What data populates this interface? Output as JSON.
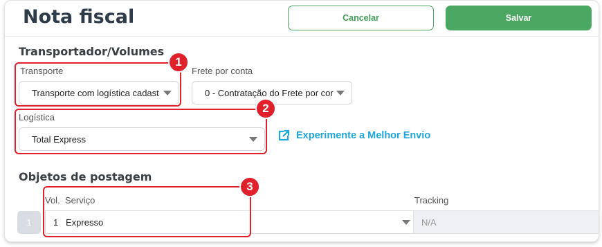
{
  "header": {
    "title": "Nota fiscal",
    "cancel_label": "Cancelar",
    "save_label": "Salvar"
  },
  "transport_section": {
    "title": "Transportador/Volumes",
    "transporte_label": "Transporte",
    "transporte_value": "Transporte com logística cadast",
    "frete_label": "Frete por conta",
    "frete_value": "0 - Contratação do Frete por cor",
    "logistica_label": "Logística",
    "logistica_value": "Total Express",
    "link_label": "Experimente a Melhor Envio"
  },
  "objects_section": {
    "title": "Objetos de postagem",
    "col_vol": "Vol.",
    "col_servico": "Serviço",
    "col_tracking": "Tracking",
    "rows": [
      {
        "num": "1",
        "vol": "1",
        "servico": "Expresso",
        "tracking": "N/A"
      }
    ]
  },
  "annotations": [
    "1",
    "2",
    "3"
  ],
  "colors": {
    "primary": "#4aa862",
    "highlight": "#e0202a",
    "link": "#1ea7db"
  }
}
